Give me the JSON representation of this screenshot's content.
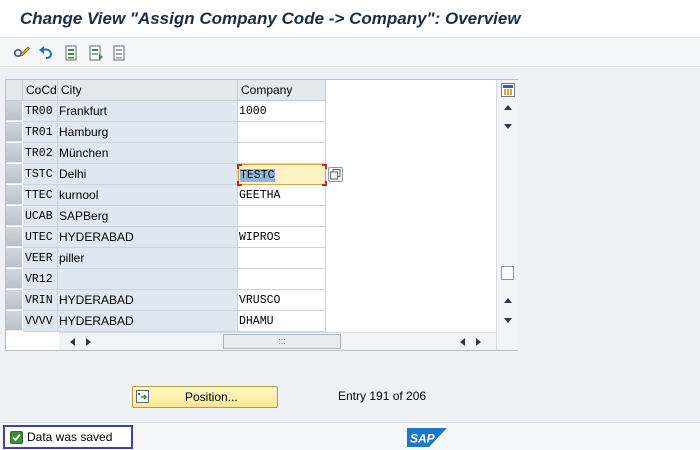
{
  "title": "Change View \"Assign Company Code -> Company\": Overview",
  "toolbar": {
    "buttons": [
      "display-change-icon",
      "undo-icon",
      "select-all-icon",
      "select-block-icon",
      "deselect-all-icon"
    ]
  },
  "table": {
    "headers": {
      "cocd": "CoCd",
      "city": "City",
      "company": "Company"
    },
    "rows": [
      {
        "cocd": "TR00",
        "city": "Frankfurt",
        "company": "1000"
      },
      {
        "cocd": "TR01",
        "city": "Hamburg",
        "company": ""
      },
      {
        "cocd": "TR02",
        "city": "München",
        "company": ""
      },
      {
        "cocd": "TSTC",
        "city": "Delhi",
        "company": "TESTC"
      },
      {
        "cocd": "TTEC",
        "city": "kurnool",
        "company": "GEETHA"
      },
      {
        "cocd": "UCAB",
        "city": "SAPBerg",
        "company": ""
      },
      {
        "cocd": "UTEC",
        "city": "HYDERABAD",
        "company": "WIPROS"
      },
      {
        "cocd": "VEER",
        "city": "piller",
        "company": ""
      },
      {
        "cocd": "VR12",
        "city": "",
        "company": ""
      },
      {
        "cocd": "VRIN",
        "city": "HYDERABAD",
        "company": "VRUSCO"
      },
      {
        "cocd": "VVVV",
        "city": "HYDERABAD",
        "company": "DHAMU"
      }
    ],
    "hscroll_grip": ":::"
  },
  "position_button": {
    "label": "Position..."
  },
  "entry": {
    "text": "Entry 191 of 206"
  },
  "status": {
    "message": "Data was saved"
  },
  "logo": {
    "text": "SAP"
  },
  "colors": {
    "title": "#1c2e45",
    "accent": "#e2a43a",
    "status_ok": "#3c8c2d",
    "sap_blue": "#1b77c9"
  }
}
